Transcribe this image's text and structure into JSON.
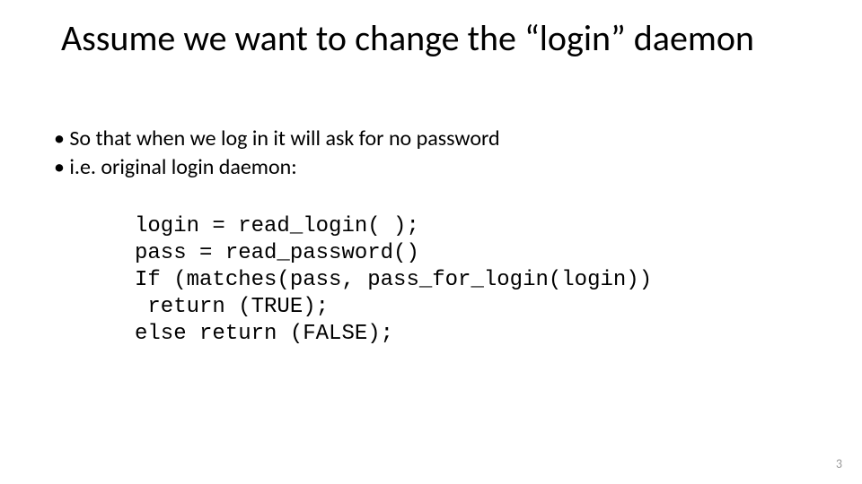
{
  "slide": {
    "title": "Assume we want to change the “login” daemon",
    "bullets": [
      "So that when we log in it will ask for no password",
      "i.e. original login daemon:"
    ],
    "code_lines": [
      "login = read_login( );",
      "pass = read_password()",
      "If (matches(pass, pass_for_login(login))",
      " return (TRUE);",
      "else return (FALSE);"
    ],
    "page_number": "3"
  }
}
